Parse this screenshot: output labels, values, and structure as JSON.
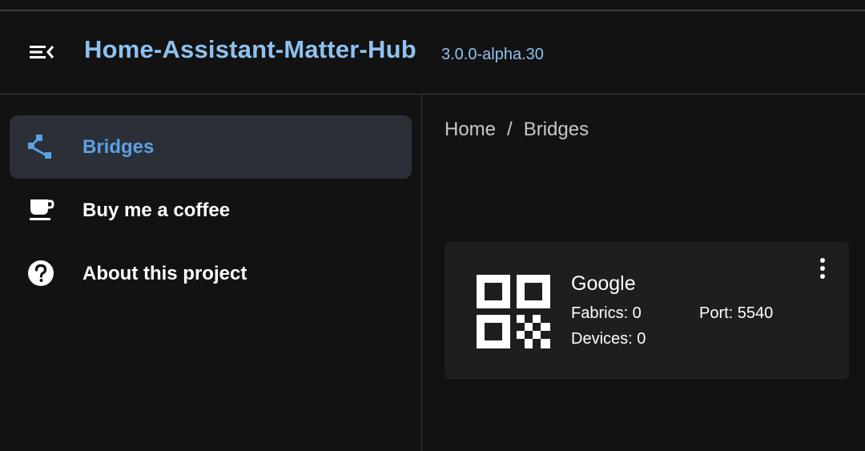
{
  "app": {
    "title": "Home-Assistant-Matter-Hub",
    "version": "3.0.0-alpha.30"
  },
  "sidebar": {
    "items": [
      {
        "label": "Bridges",
        "icon": "bridge-icon",
        "active": true
      },
      {
        "label": "Buy me a coffee",
        "icon": "coffee-icon",
        "active": false
      },
      {
        "label": "About this project",
        "icon": "help-circle-icon",
        "active": false
      }
    ]
  },
  "breadcrumb": {
    "items": [
      "Home",
      "Bridges"
    ],
    "separator": "/"
  },
  "bridges": [
    {
      "name": "Google",
      "fabrics": "Fabrics: 0",
      "devices": "Devices: 0",
      "port": "Port: 5540",
      "icon": "qr-code-icon"
    }
  ],
  "colors": {
    "accent": "#8ec1ef",
    "active_label": "#5aa1e3",
    "background": "#121212",
    "card": "#1e1e1e",
    "active_item_bg": "#2b2f37"
  }
}
